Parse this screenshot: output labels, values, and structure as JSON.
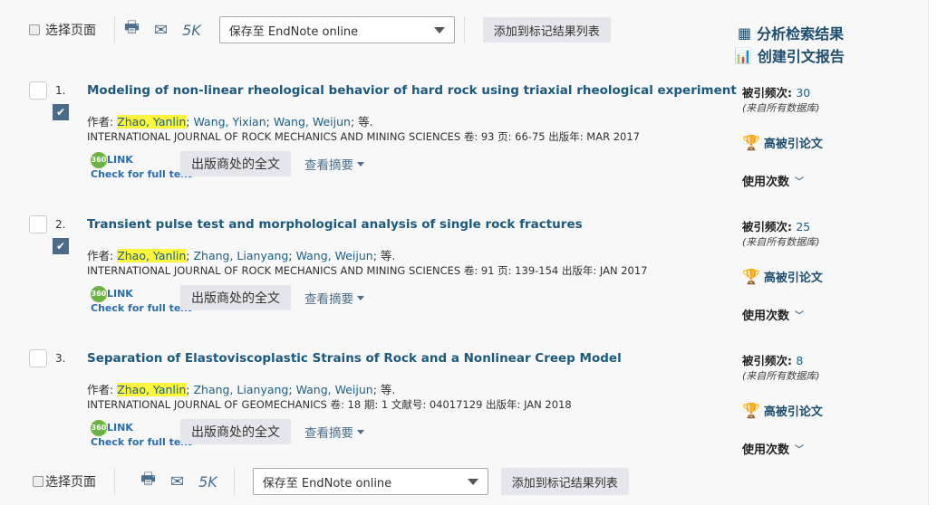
{
  "toolbar_top": {
    "select_page": "选择页面",
    "print_icon": "printer-icon",
    "email_icon": "envelope-icon",
    "k5": "5K",
    "save_to": "保存至 EndNote online",
    "add_marked": "添加到标记结果列表"
  },
  "toolbar_bottom": {
    "select_page": "选择页面",
    "k5": "5K",
    "save_to": "保存至 EndNote online",
    "add_marked": "添加到标记结果列表"
  },
  "sidebar": {
    "analyze": "分析检索结果",
    "citation_report": "创建引文报告"
  },
  "labels": {
    "author_prefix": "作者: ",
    "etal": "等.",
    "full_text": "出版商处的全文",
    "view_abstract": "查看摘要",
    "link360": "LINK",
    "link360_badge": "360",
    "check_full_text": "Check for full text",
    "times_cited": "被引频次: ",
    "all_db": "(来自所有数据库)",
    "highly_cited": "高被引论文",
    "usage": "使用次数"
  },
  "records": [
    {
      "number": "1.",
      "marked": true,
      "title": "Modeling of non-linear rheological behavior of hard rock using triaxial rheological experiment",
      "highlight_author": "Zhao, Yanlin",
      "other_authors": [
        "Wang, Yixian",
        "Wang, Weijun"
      ],
      "journal": "INTERNATIONAL JOURNAL OF ROCK MECHANICS AND MINING SCIENCES  卷: 93   页: 66-75   出版年: MAR 2017",
      "cited": "30"
    },
    {
      "number": "2.",
      "marked": true,
      "title": "Transient pulse test and morphological analysis of single rock fractures",
      "highlight_author": "Zhao, Yanlin",
      "other_authors": [
        "Zhang, Lianyang",
        "Wang, Weijun"
      ],
      "journal": "INTERNATIONAL JOURNAL OF ROCK MECHANICS AND MINING SCIENCES  卷: 91   页: 139-154   出版年: JAN 2017",
      "cited": "25"
    },
    {
      "number": "3.",
      "marked": false,
      "title": "Separation of Elastoviscoplastic Strains of Rock and a Nonlinear Creep Model",
      "highlight_author": "Zhao, Yanlin",
      "other_authors": [
        "Zhang, Lianyang",
        "Wang, Weijun"
      ],
      "journal": "INTERNATIONAL JOURNAL OF GEOMECHANICS  卷: 18   期: 1    文献号: 04017129   出版年: JAN 2018",
      "cited": "8"
    }
  ]
}
